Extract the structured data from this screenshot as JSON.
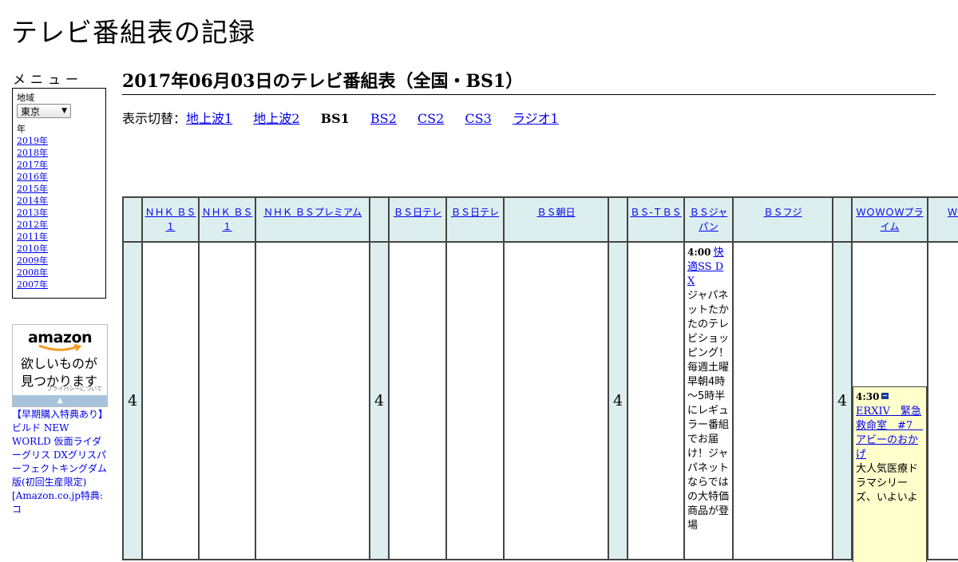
{
  "site": {
    "title": "テレビ番組表の記録"
  },
  "menu": {
    "title": "メニュー",
    "region_label": "地域",
    "region_value": "東京",
    "year_label": "年",
    "years": [
      "2019年",
      "2018年",
      "2017年",
      "2016年",
      "2015年",
      "2014年",
      "2013年",
      "2012年",
      "2011年",
      "2010年",
      "2009年",
      "2008年",
      "2007年"
    ]
  },
  "ad": {
    "logo": "amazon",
    "line1": "欲しいものが",
    "line2": "見つかります",
    "privacy": "プライバシーについて",
    "link_text": "【早期購入特典あり】ビルド NEW WORLD 仮面ライダーグリス DXグリスパーフェクトキングダム版(初回生産限定) [Amazon.co.jp特典:コ"
  },
  "page": {
    "heading": "2017年06月03日のテレビ番組表（全国・BS1）",
    "switch_label": "表示切替：",
    "switch": {
      "chijo1": "地上波1",
      "chijo2": "地上波2",
      "bs1": "BS1",
      "bs2": "BS2",
      "cs2": "CS2",
      "cs3": "CS3",
      "radio1": "ラジオ1"
    }
  },
  "schedule": {
    "hour": "4",
    "channels": {
      "nhkbs1_a": "ＮＨＫ ＢＳ１",
      "nhkbs1_b": "ＮＨＫ ＢＳ１",
      "nhkbsp": "ＮＨＫ ＢＳプレミアム",
      "bsntv_a": "ＢＳ日テレ",
      "bsntv_b": "ＢＳ日テレ",
      "bsasahi": "ＢＳ朝日",
      "bstbs": "ＢＳ-ＴＢＳ",
      "bsjapan": "ＢＳジャパン",
      "bsfuji": "ＢＳフジ",
      "wowowprime": "ＷＯＷＯＷプライム",
      "wowow_cut": "ＷＯＷラ"
    },
    "programs": {
      "bsjapan": {
        "time": "4:00",
        "title": "快適SS DX",
        "desc": "ジャパネットたかたのテレビショッピング！毎週土曜早朝4時～5時半にレギュラー番組でお届け！ジャパネットならではの大特価商品が登場"
      },
      "wowow": {
        "time": "4:30",
        "title": "ERXIV　緊急救命室　#7　アビーのおかげ",
        "desc": "大人気医療ドラマシリーズ、いよいよ"
      }
    }
  }
}
